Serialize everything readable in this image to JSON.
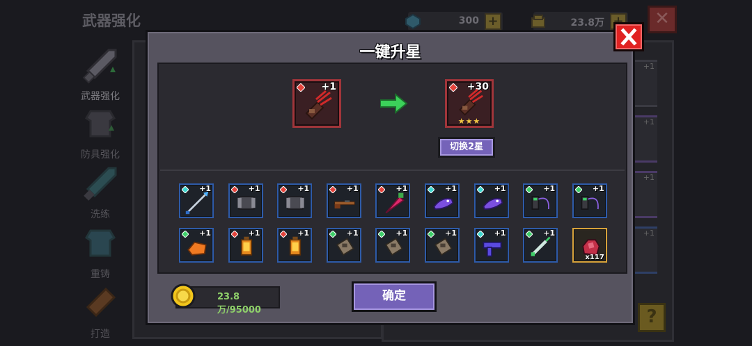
{
  "background": {
    "page_title": "武器强化",
    "gem_count": "300",
    "coin_count": "23.8万",
    "sidebar": [
      {
        "label": "武器强化",
        "active": true
      },
      {
        "label": "防具强化",
        "active": false
      },
      {
        "label": "洗练",
        "active": false
      },
      {
        "label": "重铸",
        "active": false
      },
      {
        "label": "打造",
        "active": false
      }
    ],
    "slot_plus": [
      "+1",
      "+1",
      "+1",
      "+1"
    ]
  },
  "modal": {
    "title": "一键升星",
    "current_level": "+1",
    "target_level": "+30",
    "target_stars": "★★★",
    "switch_button": "切换2星",
    "items_row1": [
      {
        "icon": "spear-icon",
        "plus": "+1",
        "gem": "cyan"
      },
      {
        "icon": "bracer-icon",
        "plus": "+1",
        "gem": "red"
      },
      {
        "icon": "bracer-icon",
        "plus": "+1",
        "gem": "red"
      },
      {
        "icon": "rifle-icon",
        "plus": "+1",
        "gem": "red"
      },
      {
        "icon": "drill-icon",
        "plus": "+1",
        "gem": "red"
      },
      {
        "icon": "fish-gun-icon",
        "plus": "+1",
        "gem": "cyan"
      },
      {
        "icon": "fish-gun-icon",
        "plus": "+1",
        "gem": "cyan"
      },
      {
        "icon": "flail-icon",
        "plus": "+1",
        "gem": "green"
      },
      {
        "icon": "flail-icon",
        "plus": "+1",
        "gem": "green"
      }
    ],
    "items_row2": [
      {
        "icon": "bread-icon",
        "plus": "+1",
        "gem": "green"
      },
      {
        "icon": "lantern-icon",
        "plus": "+1",
        "gem": "red"
      },
      {
        "icon": "lantern-icon",
        "plus": "+1",
        "gem": "red"
      },
      {
        "icon": "scroll-icon",
        "plus": "+1",
        "gem": "green"
      },
      {
        "icon": "scroll-icon",
        "plus": "+1",
        "gem": "green"
      },
      {
        "icon": "scroll-icon",
        "plus": "+1",
        "gem": "green"
      },
      {
        "icon": "uzi-icon",
        "plus": "+1",
        "gem": "cyan"
      },
      {
        "icon": "syringe-icon",
        "plus": "+1",
        "gem": "green"
      },
      {
        "icon": "ore-icon",
        "qty": "x117",
        "gem": ""
      }
    ],
    "cost_text": "23.8万/95000",
    "confirm_button": "确定"
  },
  "colors": {
    "accent_purple": "#7462b8",
    "close_red": "#e02222",
    "cost_green": "#8fd16a",
    "slot_blue": "#2e5ba9",
    "slot_gold": "#d7a23a"
  }
}
